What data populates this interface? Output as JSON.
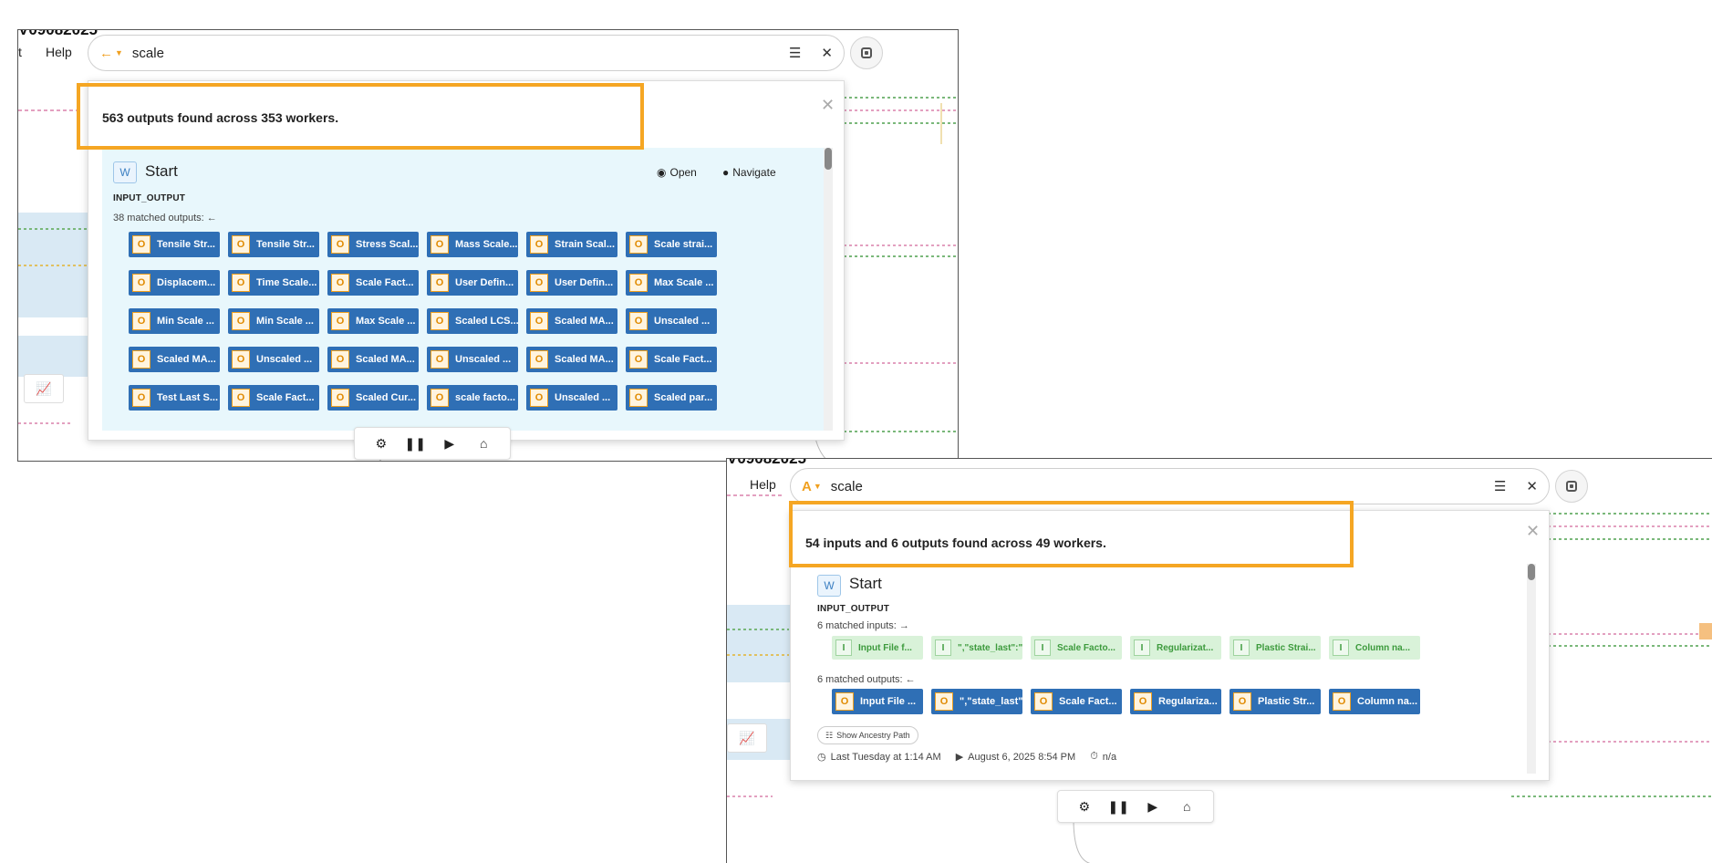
{
  "panel1": {
    "cutoff_title": "V09082025",
    "menu": [
      "t",
      "Help"
    ],
    "search": {
      "mode_icon": "arrow-left-icon",
      "value": "scale",
      "filter_icon": "sliders-icon",
      "clear_icon": "close-icon"
    },
    "summary": "563 outputs found across 353 workers.",
    "card": {
      "badge": "W",
      "name": "Start",
      "type": "INPUT_OUTPUT",
      "matched_outputs": "38 matched outputs:",
      "open_label": "Open",
      "navigate_label": "Navigate",
      "chip_tag": "O",
      "outputs": [
        "Tensile Str...",
        "Tensile Str...",
        "Stress Scal...",
        "Mass Scale...",
        "Strain Scal...",
        "Scale strai...",
        "Displacem...",
        "Time Scale...",
        "Scale Fact...",
        "User Defin...",
        "User Defin...",
        "Max Scale ...",
        "Min Scale ...",
        "Min Scale ...",
        "Max Scale ...",
        "Scaled LCS...",
        "Scaled MA...",
        "Unscaled ...",
        "Scaled MA...",
        "Unscaled ...",
        "Scaled MA...",
        "Unscaled ...",
        "Scaled MA...",
        "Scale Fact...",
        "Test Last S...",
        "Scale Fact...",
        "Scaled Cur...",
        "scale facto...",
        "Unscaled ...",
        "Scaled par..."
      ]
    },
    "toolbar": [
      "gear-icon",
      "pause-icon",
      "play-icon",
      "chart-icon"
    ]
  },
  "panel2": {
    "cutoff_title": "V09082025",
    "menu": [
      "Help"
    ],
    "search": {
      "mode_label": "A",
      "value": "scale",
      "filter_icon": "sliders-icon",
      "clear_icon": "close-icon"
    },
    "summary": "54 inputs and 6 outputs found across 49 workers.",
    "card": {
      "badge": "W",
      "name": "Start",
      "type": "INPUT_OUTPUT",
      "matched_inputs": "6 matched inputs:",
      "matched_outputs": "6 matched outputs:",
      "input_tag": "I",
      "output_tag": "O",
      "inputs": [
        "Input File f...",
        "\",\"state_last\":\"\",...",
        "Scale Facto...",
        "Regularizat...",
        "Plastic Strai...",
        "Column na..."
      ],
      "outputs": [
        "Input File ...",
        "\",\"state_last\":\"\",...",
        "Scale Fact...",
        "Regulariza...",
        "Plastic Str...",
        "Column na..."
      ],
      "ancestry_label": "Show Ancestry Path",
      "last_run": "Last Tuesday at 1:14 AM",
      "started": "August 6, 2025 8:54 PM",
      "duration": "n/a"
    },
    "toolbar": [
      "gear-icon",
      "pause-icon",
      "play-icon",
      "chart-icon"
    ]
  },
  "colors": {
    "highlight": "#f5a623",
    "output_chip": "#2f6fb5",
    "input_chip": "#d9f2d9",
    "card_bg": "#e8f7fc"
  }
}
